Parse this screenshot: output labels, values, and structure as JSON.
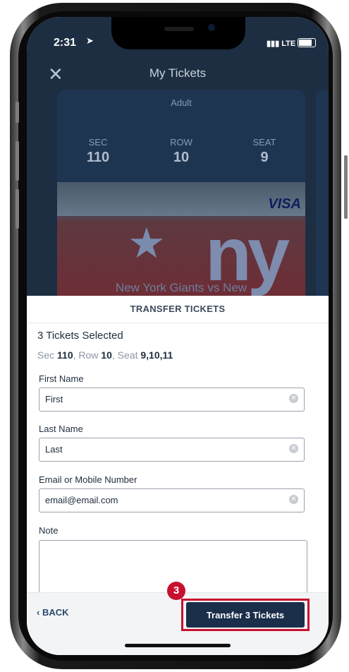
{
  "status_bar": {
    "time": "2:31",
    "location_glyph": "➤",
    "signal": "▮▮▮ LTE"
  },
  "nav": {
    "title": "My Tickets",
    "close_glyph": "✕"
  },
  "ticket": {
    "type": "Adult",
    "sec_label": "SEC",
    "sec_value": "110",
    "row_label": "ROW",
    "row_value": "10",
    "seat_label": "SEAT",
    "seat_value": "9",
    "sponsor": "VISA",
    "logo_text": "ny",
    "game_title": "New York Giants vs New"
  },
  "transfer": {
    "title": "TRANSFER TICKETS",
    "selected": "3 Tickets Selected",
    "sec_label": "Sec",
    "sec": "110",
    "row_label": "Row",
    "row": "10",
    "seat_label": "Seat",
    "seats": "9,10,11",
    "first_name_label": "First Name",
    "first_name_value": "First",
    "last_name_label": "Last Name",
    "last_name_value": "Last",
    "email_label": "Email or Mobile Number",
    "email_value": "email@email.com",
    "note_label": "Note",
    "note_value": ""
  },
  "footer": {
    "back_label": "BACK",
    "back_icon": "‹",
    "transfer_button": "Transfer 3 Tickets"
  },
  "annotation": {
    "step": "3",
    "color": "#c8102e"
  },
  "colors": {
    "primary": "#1b2f4b",
    "header_bg": "#1d2e42"
  }
}
